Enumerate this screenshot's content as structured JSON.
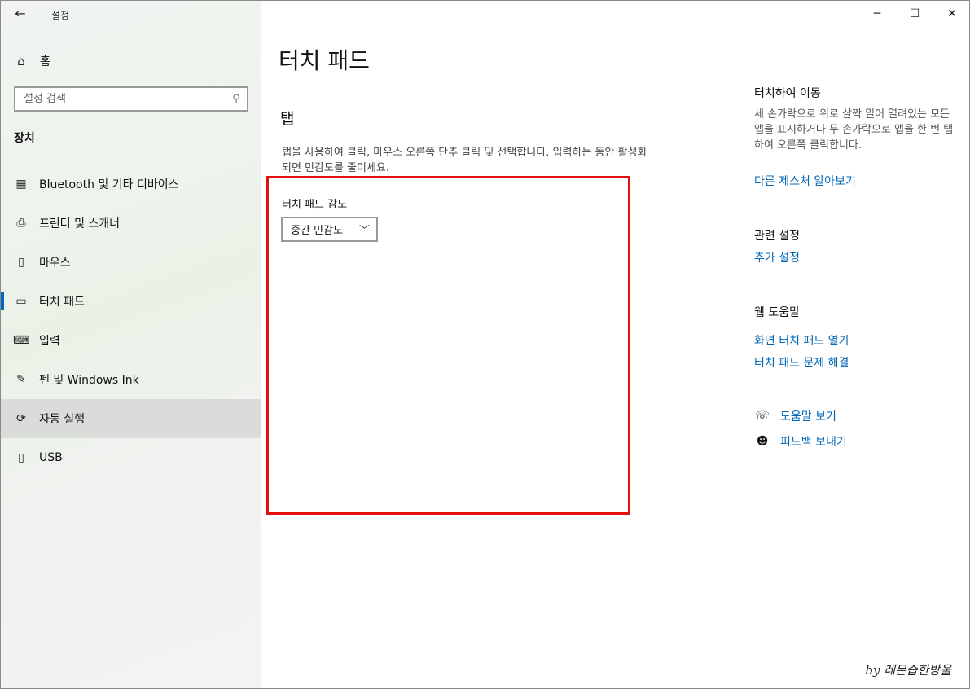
{
  "window": {
    "app_title": "설정",
    "back_icon": "←",
    "minimize_icon": "─",
    "maximize_icon": "☐",
    "close_icon": "✕"
  },
  "sidebar": {
    "home_icon": "⌂",
    "home_label": "홈",
    "search_placeholder": "설정 검색",
    "search_icon": "⚲",
    "section_title": "장치",
    "items": [
      {
        "icon": "▦",
        "label": "Bluetooth 및 기타 디바이스"
      },
      {
        "icon": "⎙",
        "label": "프린터 및 스캐너"
      },
      {
        "icon": "▯",
        "label": "마우스"
      },
      {
        "icon": "▭",
        "label": "터치 패드"
      },
      {
        "icon": "⌨",
        "label": "입력"
      },
      {
        "icon": "✎",
        "label": "펜 및 Windows Ink"
      },
      {
        "icon": "⟳",
        "label": "자동 실행"
      },
      {
        "icon": "▯",
        "label": "USB"
      }
    ],
    "selected_index": 3,
    "hover_index": 6
  },
  "main": {
    "page_title": "터치 패드",
    "section_title": "탭",
    "description": "탭을 사용하여 클릭, 마우스 오른쪽 단추 클릭 및 선택합니다. 입력하는 동안 활성화되면 민감도를 줄이세요.",
    "sensitivity_label": "터치 패드 감도",
    "sensitivity_value": "중간 민감도",
    "chevron_icon": "﹀"
  },
  "right": {
    "swipe_heading": "터치하여 이동",
    "swipe_text": "세 손가락으로 위로 살짝 밀어 열려있는 모든 앱을 표시하거나 두 손가락으로 앱을 한 번 탭하여 오른쪽 클릭합니다.",
    "gestures_link": "다른 제스처 알아보기",
    "related_heading": "관련 설정",
    "related_link": "추가 설정",
    "web_help_heading": "웹 도움말",
    "web_links": [
      "화면 터치 패드 열기",
      "터치 패드 문제 해결"
    ],
    "help_items": [
      {
        "icon": "☏",
        "label": "도움말 보기"
      },
      {
        "icon": "☻",
        "label": "피드백 보내기"
      }
    ]
  },
  "watermark": "by 레몬즙한방울",
  "colors": {
    "accent": "#0067b8",
    "highlight_box": "#e01010",
    "selection_bar": "#0067c0"
  }
}
